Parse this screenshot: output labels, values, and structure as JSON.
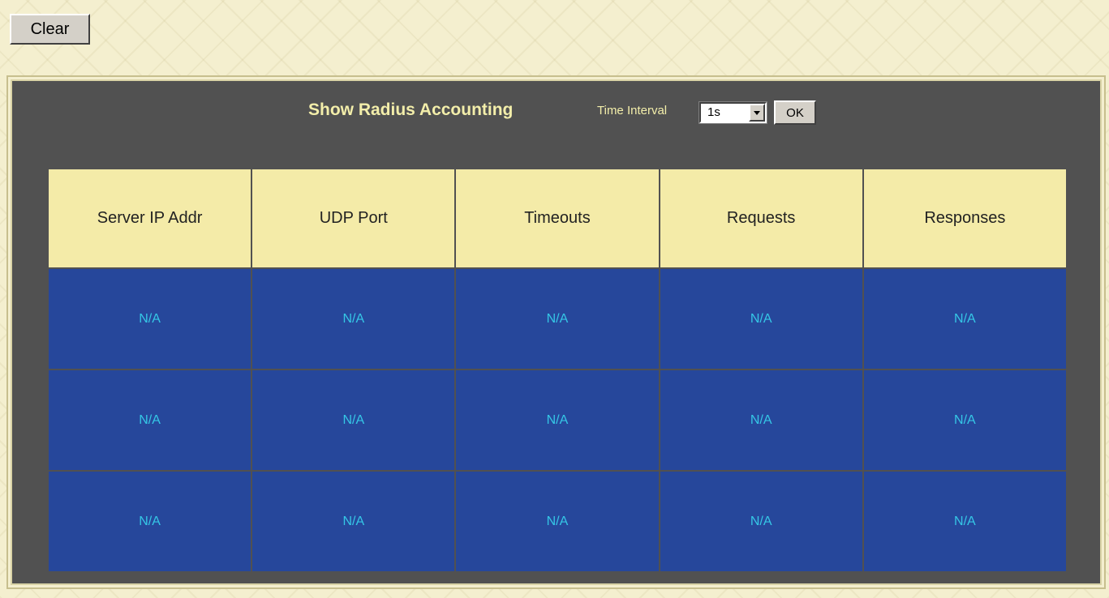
{
  "toolbar": {
    "clear_label": "Clear"
  },
  "panel": {
    "title": "Show Radius Accounting",
    "time_interval_label": "Time Interval",
    "time_interval_value": "1s",
    "ok_label": "OK"
  },
  "table": {
    "columns": [
      "Server IP Addr",
      "UDP Port",
      "Timeouts",
      "Requests",
      "Responses"
    ],
    "rows": [
      [
        "N/A",
        "N/A",
        "N/A",
        "N/A",
        "N/A"
      ],
      [
        "N/A",
        "N/A",
        "N/A",
        "N/A",
        "N/A"
      ],
      [
        "N/A",
        "N/A",
        "N/A",
        "N/A",
        "N/A"
      ]
    ]
  },
  "colors": {
    "panel_background": "#515151",
    "title_text": "#f3eeaa",
    "header_cell": "#f4eba8",
    "data_cell": "#26479b",
    "data_text": "#35c7e6"
  }
}
